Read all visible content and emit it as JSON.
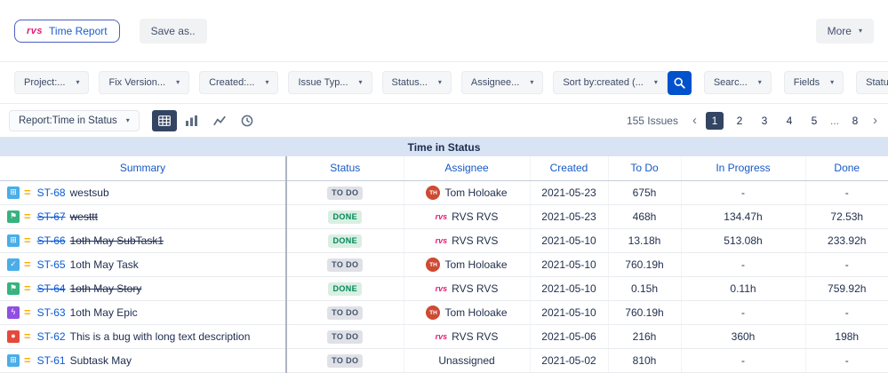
{
  "colors": {
    "accent_blue": "#0052CC",
    "brand_pink": "#E41A74",
    "active_navy": "#344563",
    "todo_badge_bg": "#DFE1E6",
    "todo_badge_text": "#42526E",
    "done_badge_bg": "#D9EFE2",
    "done_badge_text": "#00875A",
    "table_title_bg": "#D8E4F3"
  },
  "icons": {
    "chevron_down": "▾",
    "chevron_left": "‹",
    "chevron_right": "›",
    "priority_medium": "=",
    "search": "magnifier"
  },
  "issue_type_icons": {
    "subtask": {
      "glyph": "⊞",
      "color": "#4BADE8"
    },
    "story": {
      "glyph": "⚑",
      "color": "#36B37E"
    },
    "task": {
      "glyph": "✓",
      "color": "#4BADE8"
    },
    "epic": {
      "glyph": "ϟ",
      "color": "#904EE2"
    },
    "bug": {
      "glyph": "●",
      "color": "#E5493A"
    }
  },
  "toolbar": {
    "time_report_button": {
      "logo": "rvs",
      "label": "Time Report"
    },
    "save_as_label": "Save as..",
    "more_label": "More"
  },
  "filter_bar": {
    "filters": [
      {
        "name": "filter-project",
        "label": "Project:..."
      },
      {
        "name": "filter-fix-version",
        "label": "Fix Version..."
      },
      {
        "name": "filter-created",
        "label": "Created:..."
      },
      {
        "name": "filter-issue-type",
        "label": "Issue Typ..."
      },
      {
        "name": "filter-status",
        "label": "Status..."
      },
      {
        "name": "filter-assignee",
        "label": "Assignee..."
      },
      {
        "name": "filter-sort-by",
        "label": "Sort by:created (..."
      }
    ],
    "right_filters": [
      {
        "name": "filter-search-text",
        "label": "Searc..."
      },
      {
        "name": "filter-fields",
        "label": "Fields"
      },
      {
        "name": "filter-statuses",
        "label": "Statuses"
      }
    ]
  },
  "report_bar": {
    "report_selector": "Report:Time in Status",
    "view_toggles": [
      {
        "name": "table-view",
        "icon": "table",
        "active": true
      },
      {
        "name": "bar-chart-view",
        "icon": "bar",
        "active": false
      },
      {
        "name": "line-chart-view",
        "icon": "line",
        "active": false
      },
      {
        "name": "time-view",
        "icon": "clock",
        "active": false
      }
    ],
    "issues_count": "155 Issues",
    "pagination": {
      "pages": [
        "1",
        "2",
        "3",
        "4",
        "5",
        "...",
        "8"
      ],
      "active": "1"
    }
  },
  "table": {
    "title": "Time in Status",
    "columns": [
      "Summary",
      "Status",
      "Assignee",
      "Created",
      "To Do",
      "In Progress",
      "Done"
    ],
    "rows": [
      {
        "type": "subtask",
        "key": "ST-68",
        "summary": "westsub",
        "resolved": false,
        "status": "TO DO",
        "status_kind": "todo",
        "assignee": "Tom Holoake",
        "avatar": {
          "kind": "initials",
          "text": "TH"
        },
        "created": "2021-05-23",
        "to_do": "675h",
        "in_progress": "-",
        "done": "-"
      },
      {
        "type": "story",
        "key": "ST-67",
        "summary": "westtt",
        "resolved": true,
        "status": "DONE",
        "status_kind": "done",
        "assignee": "RVS RVS",
        "avatar": {
          "kind": "logo",
          "text": "rvs"
        },
        "created": "2021-05-23",
        "to_do": "468h",
        "in_progress": "134.47h",
        "done": "72.53h"
      },
      {
        "type": "subtask",
        "key": "ST-66",
        "summary": "1oth May SubTask1",
        "resolved": true,
        "status": "DONE",
        "status_kind": "done",
        "assignee": "RVS RVS",
        "avatar": {
          "kind": "logo",
          "text": "rvs"
        },
        "created": "2021-05-10",
        "to_do": "13.18h",
        "in_progress": "513.08h",
        "done": "233.92h"
      },
      {
        "type": "task",
        "key": "ST-65",
        "summary": "1oth May Task",
        "resolved": false,
        "status": "TO DO",
        "status_kind": "todo",
        "assignee": "Tom Holoake",
        "avatar": {
          "kind": "initials",
          "text": "TH"
        },
        "created": "2021-05-10",
        "to_do": "760.19h",
        "in_progress": "-",
        "done": "-"
      },
      {
        "type": "story",
        "key": "ST-64",
        "summary": "1oth May Story",
        "resolved": true,
        "status": "DONE",
        "status_kind": "done",
        "assignee": "RVS RVS",
        "avatar": {
          "kind": "logo",
          "text": "rvs"
        },
        "created": "2021-05-10",
        "to_do": "0.15h",
        "in_progress": "0.11h",
        "done": "759.92h"
      },
      {
        "type": "epic",
        "key": "ST-63",
        "summary": "1oth May Epic",
        "resolved": false,
        "status": "TO DO",
        "status_kind": "todo",
        "assignee": "Tom Holoake",
        "avatar": {
          "kind": "initials",
          "text": "TH"
        },
        "created": "2021-05-10",
        "to_do": "760.19h",
        "in_progress": "-",
        "done": "-"
      },
      {
        "type": "bug",
        "key": "ST-62",
        "summary": "This is a bug with long text description",
        "resolved": false,
        "status": "TO DO",
        "status_kind": "todo",
        "assignee": "RVS RVS",
        "avatar": {
          "kind": "logo",
          "text": "rvs"
        },
        "created": "2021-05-06",
        "to_do": "216h",
        "in_progress": "360h",
        "done": "198h"
      },
      {
        "type": "subtask",
        "key": "ST-61",
        "summary": "Subtask May",
        "resolved": false,
        "status": "TO DO",
        "status_kind": "todo",
        "assignee": "Unassigned",
        "avatar": null,
        "created": "2021-05-02",
        "to_do": "810h",
        "in_progress": "-",
        "done": "-"
      }
    ]
  }
}
